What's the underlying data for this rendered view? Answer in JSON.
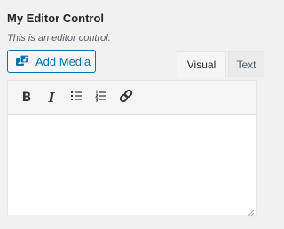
{
  "control": {
    "title": "My Editor Control",
    "description": "This is an editor control."
  },
  "media": {
    "add_label": "Add Media"
  },
  "tabs": {
    "visual": "Visual",
    "text": "Text",
    "active": "Visual"
  },
  "toolbar": {
    "bold_label": "B",
    "italic_label": "I",
    "buttons": [
      "bold-icon",
      "italic-icon",
      "bullet-list-icon",
      "numbered-list-icon",
      "link-icon"
    ]
  },
  "colors": {
    "accent": "#0073aa",
    "background": "#f1f1f1",
    "text": "#23282d"
  }
}
